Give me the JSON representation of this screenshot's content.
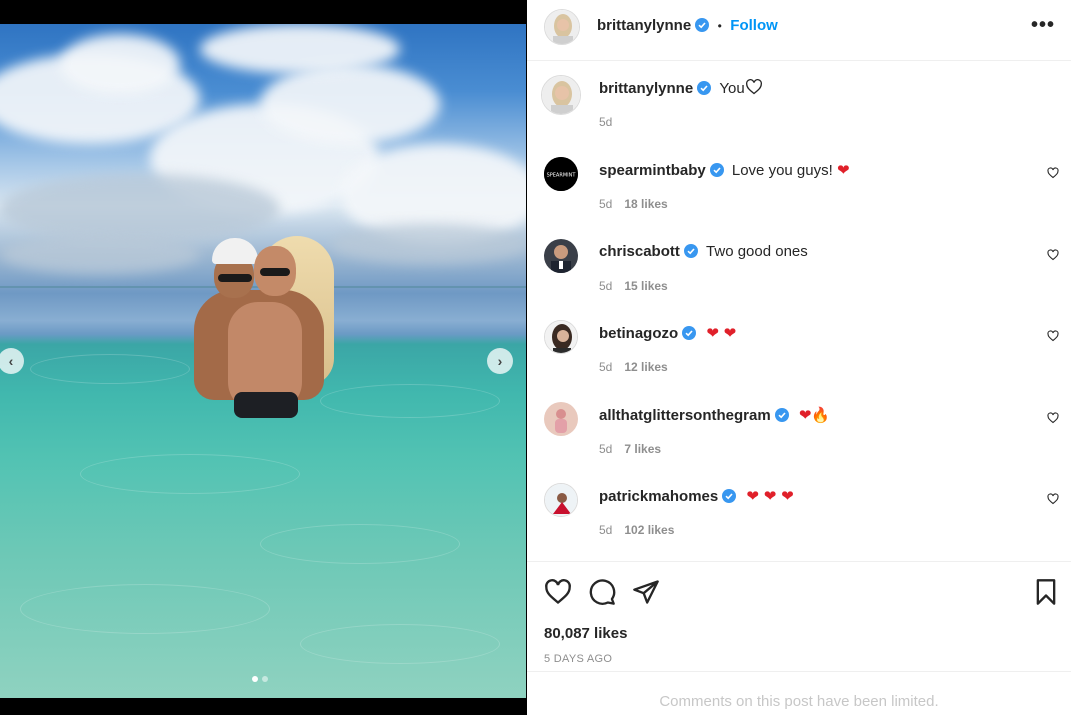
{
  "post": {
    "author": "brittanylynne",
    "follow_label": "Follow",
    "separator": "•",
    "more_label": "•••",
    "caption": "You",
    "caption_age": "5d",
    "likes": "80,087 likes",
    "date": "5 DAYS AGO",
    "comments_limited": "Comments on this post have been limited.",
    "carousel": {
      "slides": 2,
      "active": 1
    }
  },
  "comments": [
    {
      "user": "spearmintbaby",
      "text": "Love you guys!",
      "emoji": "❤",
      "age": "5d",
      "likes": "18 likes",
      "avatar_label": "SPEARMINT"
    },
    {
      "user": "chriscabott",
      "text": "Two good ones",
      "emoji": "",
      "age": "5d",
      "likes": "15 likes"
    },
    {
      "user": "betinagozo",
      "text": "",
      "emoji": "❤ ❤",
      "age": "5d",
      "likes": "12 likes"
    },
    {
      "user": "allthatglittersonthegram",
      "text": "",
      "emoji": "❤🔥",
      "age": "5d",
      "likes": "7 likes"
    },
    {
      "user": "patrickmahomes",
      "text": "",
      "emoji": "❤ ❤ ❤",
      "age": "5d",
      "likes": "102 likes"
    }
  ],
  "icons": {
    "verified": "verified-badge-icon",
    "like": "heart-icon",
    "comment": "comment-bubble-icon",
    "share": "paper-plane-icon",
    "save": "bookmark-icon",
    "prev": "chevron-left-icon",
    "next": "chevron-right-icon"
  },
  "colors": {
    "accent": "#0095f6",
    "verified": "#3897f0",
    "heart": "#e0202a",
    "muted": "#8e8e8e"
  }
}
